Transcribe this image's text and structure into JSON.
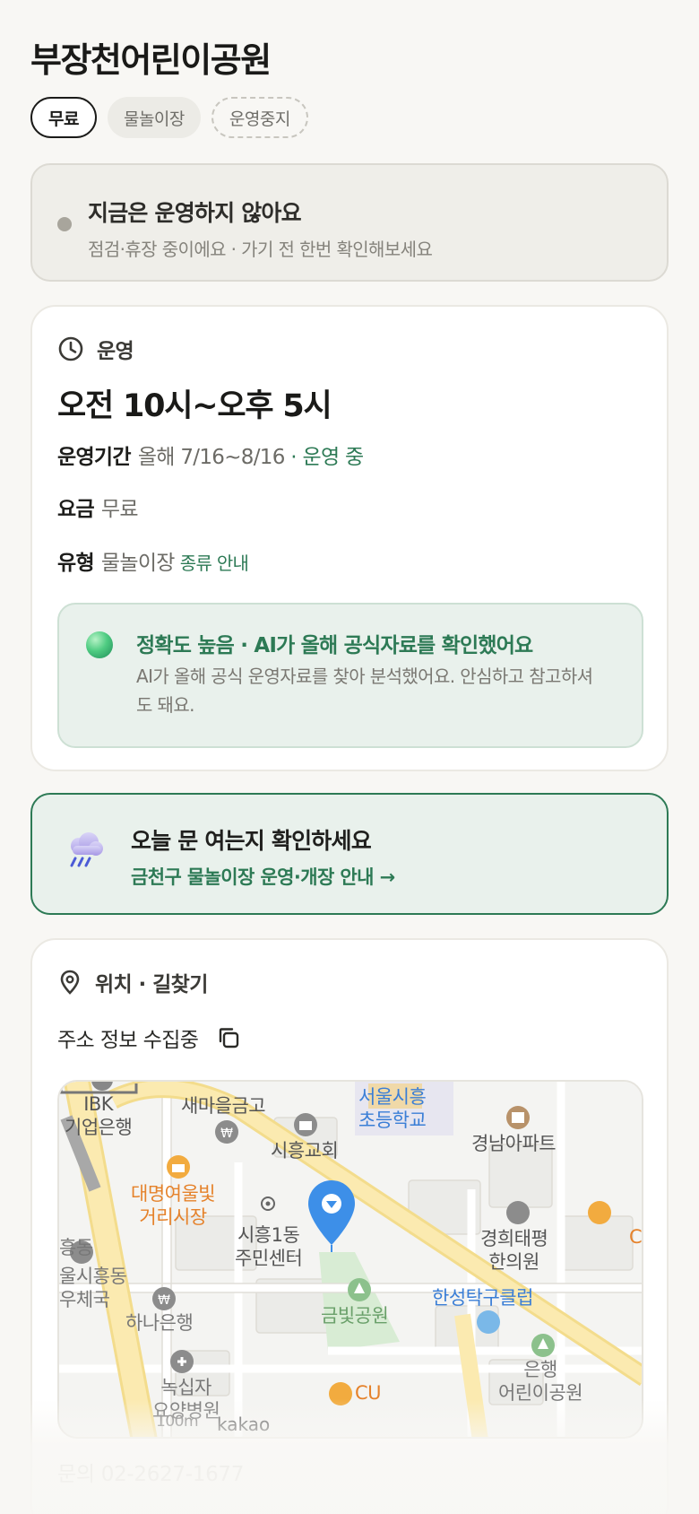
{
  "page": {
    "title": "부장천어린이공원"
  },
  "chips": [
    {
      "label": "무료"
    },
    {
      "label": "물놀이장"
    },
    {
      "label": "운영중지"
    }
  ],
  "status_card": {
    "title": "지금은 운영하지 않아요",
    "subtitle": "점검·휴장 중이에요 · 가기 전 한번 확인해보세요"
  },
  "operation": {
    "section_label": "운영",
    "hours": "오전 10시~오후 5시",
    "period_label": "운영기간",
    "period_value": "올해 7/16~8/16",
    "period_status": "· 운영 중",
    "fee_label": "요금",
    "fee_value": "무료",
    "type_label": "유형",
    "type_value": "물놀이장",
    "type_link": "종류 안내",
    "ai": {
      "title": "정확도 높음 · AI가 올해 공식자료를 확인했어요",
      "body": "AI가 올해 공식 운영자료를 찾아 분석했어요. 안심하고 참고하셔도 돼요."
    }
  },
  "notice": {
    "title": "오늘 문 여는지 확인하세요",
    "link": "금천구 물놀이장 운영·개장 안내 →"
  },
  "location": {
    "section_label": "위치 · 길찾기",
    "address": "주소 정보 수집중",
    "map": {
      "labels": {
        "ibk": "IBK\n기업은행",
        "saemaeul": "새마을금고",
        "school": "서울시흥\n초등학교",
        "church": "시흥교회",
        "apt": "경남아파트",
        "market": "대명여울빛\n거리시장",
        "center": "시흥1동\n주민센터",
        "clinic": "경희태평\n한의원",
        "post_a": "흥동",
        "post_b": "울시흥동\n우체국",
        "hana": "하나은행",
        "park": "금빛공원",
        "table_tennis": "한성탁구클럽",
        "cu": "CU",
        "cu_edge": "C",
        "hospital": "녹십자\n요양병원",
        "kids_park": "은행\n어린이공원",
        "scale": "100m",
        "attribution": "kakao"
      }
    }
  },
  "contact": "문의 02-2627-1677"
}
